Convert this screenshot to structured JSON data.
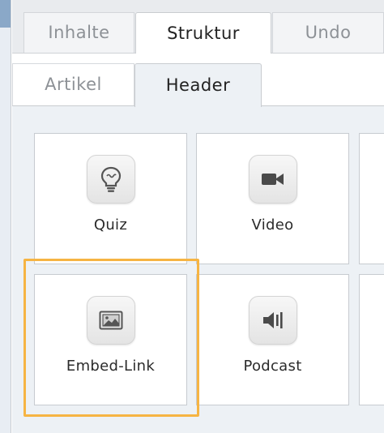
{
  "tabs_main": [
    {
      "label": "Inhalte",
      "active": false
    },
    {
      "label": "Struktur",
      "active": true
    },
    {
      "label": "Undo",
      "active": false
    }
  ],
  "tabs_sub": [
    {
      "label": "Artikel",
      "active": false
    },
    {
      "label": "Header",
      "active": true
    }
  ],
  "tiles": [
    {
      "label": "Quiz",
      "icon": "lightbulb-icon"
    },
    {
      "label": "Video",
      "icon": "video-camera-icon"
    },
    {
      "label": "Embed-Link",
      "icon": "embed-image-icon",
      "highlighted": true
    },
    {
      "label": "Podcast",
      "icon": "speaker-icon"
    }
  ],
  "colors": {
    "highlight": "#f6b443",
    "content_bg": "#edf1f5",
    "accent_strip": "#8aa8c8"
  }
}
